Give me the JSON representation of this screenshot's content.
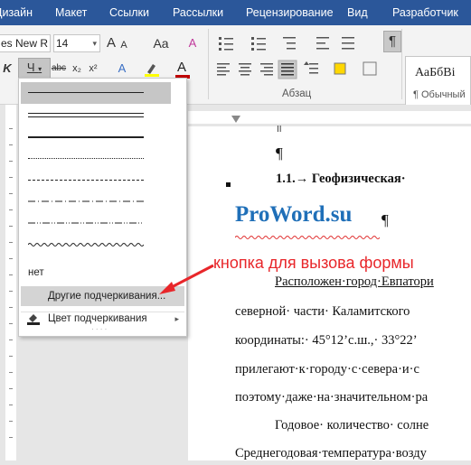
{
  "tabs": [
    "Дизайн",
    "Макет",
    "Ссылки",
    "Рассылки",
    "Рецензирование",
    "Вид",
    "Разработчик"
  ],
  "ribbon": {
    "font_name": "es New R",
    "font_size": "14",
    "font_grow": "A",
    "font_shrink": "A",
    "change_case": "Aa",
    "clear_format": "A",
    "bold_partial": "K",
    "underline": "Ч",
    "strikethrough": "abc",
    "subscript": "x₂",
    "superscript": "x²",
    "text_effects": "A",
    "font_color_btn": "A",
    "paragraph_group": "Абзац",
    "pilcrow": "¶",
    "style_sample": "АаБбВі",
    "style_name": "¶ Обычный"
  },
  "ruler": {
    "mark": "II"
  },
  "doc": {
    "pilcrow": "¶",
    "heading": "1.1.→ Геофизическая·",
    "watermark": "ProWord.su",
    "watermark_mark": "¶",
    "lines": [
      "Расположен·город·Евпатори",
      "северной· части· Каламитского",
      "координаты:· 45°12’с.ш.,· 33°22’",
      "прилегают·к·городу·с·севера·и·с",
      "поэтому·даже·на·значительном·ра",
      "Годовое· количество· солне",
      "Среднегодовая·температура·возду"
    ]
  },
  "dropdown": {
    "none_label": "нет",
    "more_label": "Другие подчеркивания...",
    "color_label": "Цвет подчеркивания",
    "color_arrow": "▸",
    "grip": "· · · ·",
    "accent_color": "#c00000"
  },
  "annotation": {
    "text": "кнопка для вызова формы",
    "color": "#e8262a"
  }
}
